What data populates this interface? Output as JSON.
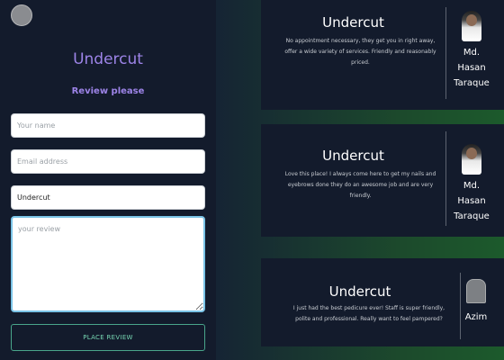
{
  "form": {
    "title": "Undercut",
    "subtitle": "Review please",
    "name_placeholder": "Your name",
    "email_placeholder": "Email address",
    "salon_value": "Undercut",
    "review_placeholder": "your review",
    "submit_label": "PLACE REVIEW"
  },
  "reviews": [
    {
      "title": "Undercut",
      "text": "No appointment necessary, they get you in right away, offer a wide variety of services. Friendly and reasonably priced.",
      "reviewer_line1": "Md.",
      "reviewer_line2": "Hasan",
      "reviewer_line3": "Taraque",
      "photo_icon": "reviewer-photo"
    },
    {
      "title": "Undercut",
      "text": "Love this place! I always come here to get my nails and eyebrows done they do an awesome job and are very friendly.",
      "reviewer_line1": "Md.",
      "reviewer_line2": "Hasan",
      "reviewer_line3": "Taraque",
      "photo_icon": "reviewer-photo"
    },
    {
      "title": "Undercut",
      "text": "I just had the best pedicure ever! Staff is super friendly, polite and professional. Really want to feel pampered?",
      "reviewer_line1": "Azim",
      "photo_icon": "avatar-placeholder"
    }
  ],
  "colors": {
    "accent": "#9d84e8",
    "button_border": "#49a58b",
    "button_text": "#76d6b2",
    "panel_bg": "#131b2c",
    "gradient_green": "#1c5a2c"
  }
}
